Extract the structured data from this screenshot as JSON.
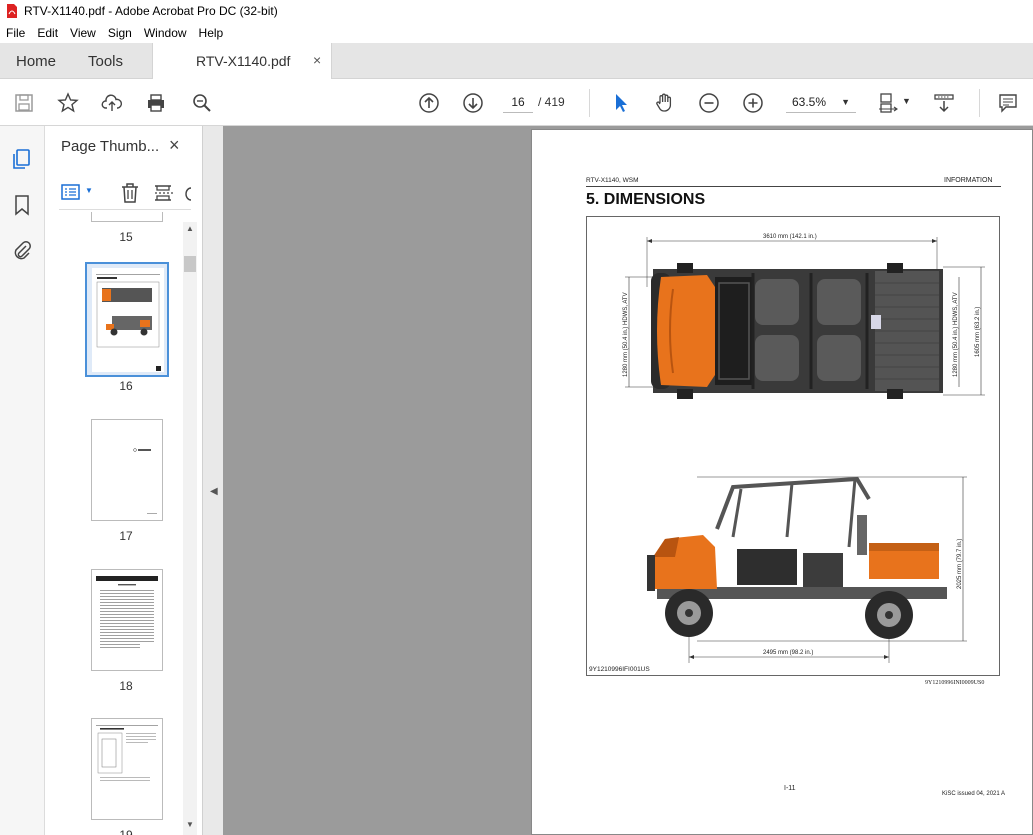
{
  "window": {
    "title": "RTV-X1140.pdf - Adobe Acrobat Pro DC (32-bit)"
  },
  "menu": [
    "File",
    "Edit",
    "View",
    "Sign",
    "Window",
    "Help"
  ],
  "tabs": {
    "home": "Home",
    "tools": "Tools",
    "document": "RTV-X1140.pdf",
    "close": "×"
  },
  "toolbar": {
    "current_page": "16",
    "page_total": "/  419",
    "zoom": "63.5%",
    "icons": [
      "save-icon",
      "star-icon",
      "upload-icon",
      "print-icon",
      "zoom-search-icon",
      "prev-page-icon",
      "next-page-icon",
      "select-cursor-icon",
      "hand-icon",
      "zoom-out-icon",
      "zoom-in-icon",
      "fit-page-icon",
      "scroll-mode-icon",
      "comment-icon"
    ]
  },
  "thumbnail_panel": {
    "title": "Page Thumb...",
    "close": "×",
    "pages": [
      {
        "number": "15"
      },
      {
        "number": "16",
        "selected": true
      },
      {
        "number": "17"
      },
      {
        "number": "18"
      },
      {
        "number": "19"
      }
    ]
  },
  "page": {
    "header_left": "RTV-X1140, WSM",
    "header_right": "INFORMATION",
    "title": "5.  DIMENSIONS",
    "dims": {
      "overall_length": "3610 mm (142.1 in.)",
      "width_left": "1280 mm (50.4 in.) HDWS, ATV",
      "width_right_a": "1280 mm (50.4 in.) HDWS, ATV",
      "width_right_b": "1605 mm (63.2 in.)",
      "height": "2025 mm (79.7 in.)",
      "wheelbase": "2495 mm (98.2 in.)"
    },
    "figure_code_left": "9Y1210996IFI001US",
    "figure_code_right": "9Y1210996INI0009US0",
    "footer_center": "I-11",
    "footer_right": "KiSC issued 04, 2021 A"
  },
  "colors": {
    "accent_orange": "#e8731c",
    "selection_blue": "#4a90d9",
    "doc_gray": "#9b9b9b"
  }
}
